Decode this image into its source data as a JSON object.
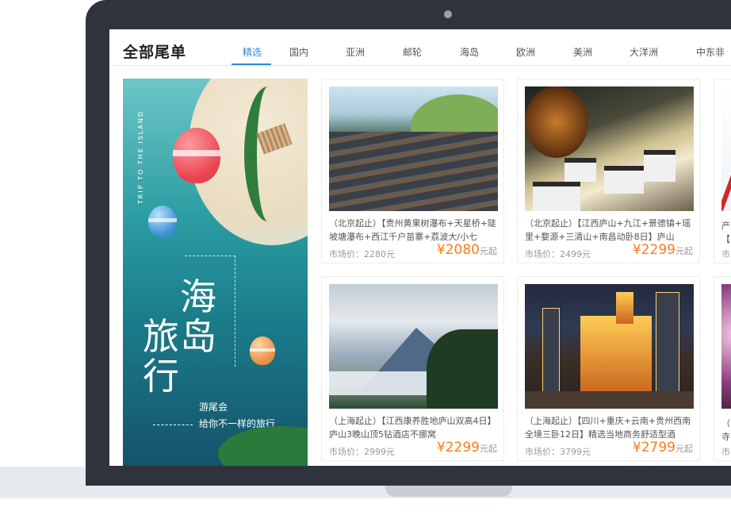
{
  "page": {
    "title": "全部尾单"
  },
  "tabs": [
    {
      "label": "精选",
      "active": true
    },
    {
      "label": "国内",
      "active": false
    },
    {
      "label": "亚洲",
      "active": false
    },
    {
      "label": "邮轮",
      "active": false
    },
    {
      "label": "海岛",
      "active": false
    },
    {
      "label": "欧洲",
      "active": false
    },
    {
      "label": "美洲",
      "active": false
    },
    {
      "label": "大洋洲",
      "active": false
    },
    {
      "label": "中东非",
      "active": false
    }
  ],
  "colors": {
    "accent": "#2a8ce0",
    "price": "#ff7a1a",
    "frame": "#2f343c"
  },
  "banner": {
    "vertical_text": "TRIP TO THE ISLAND",
    "headline_1": "海岛",
    "headline_2": "旅行",
    "sub_1": "游尾会",
    "sub_2": "给你不一样的旅行"
  },
  "products": [
    {
      "desc": "（北京起止）【贵州黄果树瀑布+天星桥+陡坡塘瀑布+西江千户苗寨+荔波大/小七",
      "market_label": "市场价：",
      "market_price": "2280元",
      "price": "¥2080",
      "price_unit": "元起",
      "image": "miao-village-photo"
    },
    {
      "desc": "（北京起止）【江西庐山+九江+景德镇+瑶里+婺源+三清山+南昌动卧8日】庐山",
      "market_label": "市场价：",
      "market_price": "2499元",
      "price": "¥2299",
      "price_unit": "元起",
      "image": "anhui-village-photo"
    },
    {
      "desc": "（上海起止）【江西康养胜地庐山双高4日】庐山3晚山顶5钻酒店不挪窝",
      "market_label": "市场价：",
      "market_price": "2999元",
      "price": "¥2299",
      "price_unit": "元起",
      "image": "lushan-mountain-photo"
    },
    {
      "desc": "（上海起止）【四川+重庆+云南+贵州西南全境三卧12日】精选当地商务舒适型酒",
      "market_label": "市场价：",
      "market_price": "3799元",
      "price": "¥2799",
      "price_unit": "元起",
      "image": "chongqing-night-photo"
    }
  ],
  "partial_cards": [
    {
      "line1": "产",
      "line2": "【",
      "line3": "市"
    },
    {
      "line1": "（",
      "line2": "寺",
      "line3": "市"
    }
  ]
}
